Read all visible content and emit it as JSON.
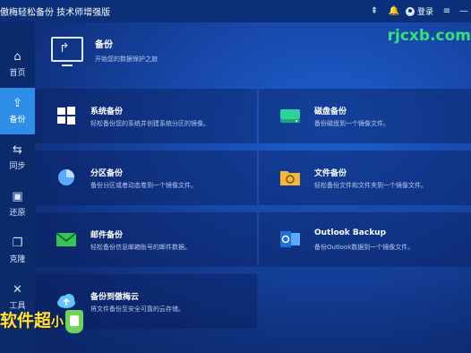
{
  "titlebar": {
    "title": "傲梅轻松备份 技术师增强版",
    "login_label": "登录"
  },
  "sidebar": {
    "items": [
      {
        "label": "首页",
        "icon": "home-icon"
      },
      {
        "label": "备份",
        "icon": "backup-icon",
        "active": true
      },
      {
        "label": "同步",
        "icon": "sync-icon"
      },
      {
        "label": "还原",
        "icon": "restore-icon"
      },
      {
        "label": "克隆",
        "icon": "clone-icon"
      },
      {
        "label": "工具",
        "icon": "tools-icon"
      }
    ]
  },
  "header": {
    "title": "备份",
    "subtitle": "开始您的数据保护之旅"
  },
  "cards": [
    {
      "title": "系统备份",
      "desc": "轻松备份您的系统并创建系统分区的镜像。",
      "icon": "windows-icon",
      "color": "#ffffff"
    },
    {
      "title": "磁盘备份",
      "desc": "备份磁盘到一个镜像文件。",
      "icon": "disk-icon",
      "color": "#2ed19a"
    },
    {
      "title": "分区备份",
      "desc": "备份分区或者动态卷到一个镜像文件。",
      "icon": "partition-icon",
      "color": "#5aa8ff"
    },
    {
      "title": "文件备份",
      "desc": "轻松备份文件和文件夹到一个镜像文件。",
      "icon": "folder-icon",
      "color": "#f2b63a"
    },
    {
      "title": "邮件备份",
      "desc": "轻松备份信息邮箱账号的邮件数据。",
      "icon": "mail-icon",
      "color": "#36c45a"
    },
    {
      "title": "Outlook Backup",
      "desc": "备份Outlook数据到一个镜像文件。",
      "icon": "outlook-icon",
      "color": "#1f6fd6"
    },
    {
      "title": "备份到傲梅云",
      "desc": "将文件备份至安全可靠的云存储。",
      "icon": "cloud-upload-icon",
      "color": "#5fc6ff"
    }
  ],
  "watermarks": {
    "top": "rjcxb.com",
    "bottom": "软件超",
    "bottom_small": "小"
  }
}
